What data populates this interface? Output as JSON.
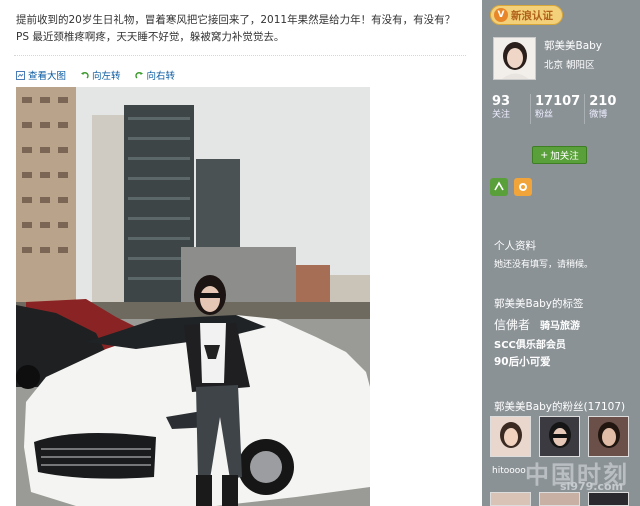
{
  "post": {
    "text": "提前收到的20岁生日礼物，冒着寒风把它接回来了，2011年果然是给力年！有没有，有没有？ PS 最近颈椎疼啊疼，天天睡不好觉，躲被窝力补觉觉去。",
    "tools": {
      "view_large": "查看大图",
      "rotate_left": "向左转",
      "rotate_right": "向右转"
    }
  },
  "sidebar": {
    "verify_label": "新浪认证",
    "user": {
      "name": "郭美美Baby",
      "location": "北京  朝阳区"
    },
    "stats": [
      {
        "num": "93",
        "label": "关注"
      },
      {
        "num": "17107",
        "label": "粉丝"
      },
      {
        "num": "210",
        "label": "微博"
      }
    ],
    "follow_label": "加关注",
    "profile": {
      "title": "个人资料",
      "sub": "她还没有填写，请稍候。"
    },
    "tags": {
      "title": "郭美美Baby的标签",
      "items": [
        "信佛者",
        "骑马旅游",
        "SCC俱乐部会员",
        "90后小可爱"
      ]
    },
    "fans": {
      "title": "郭美美Baby的粉丝(17107)",
      "first_name": "hitoooo"
    }
  },
  "watermark": {
    "text": "中国时刻",
    "site": "sl979.com"
  },
  "colors": {
    "sidebar_bg": "#8b9296",
    "link": "#0a5aa0",
    "follow_green": "#5aa03a"
  }
}
